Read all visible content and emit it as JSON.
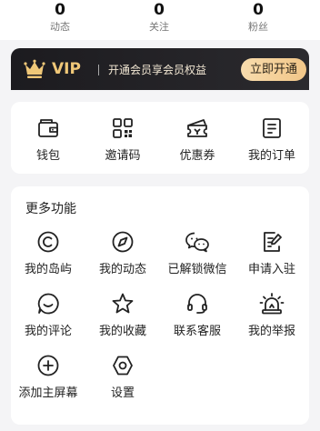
{
  "stats": [
    {
      "value": "0",
      "label": "动态"
    },
    {
      "value": "0",
      "label": "关注"
    },
    {
      "value": "0",
      "label": "粉丝"
    }
  ],
  "vip": {
    "badge": "VIP",
    "tagline": "开通会员享会员权益",
    "button": "立即开通",
    "icon": "crown-icon",
    "gold": "#f0c878"
  },
  "wallet_row": [
    {
      "label": "钱包",
      "icon": "wallet-icon"
    },
    {
      "label": "邀请码",
      "icon": "qr-code-icon"
    },
    {
      "label": "优惠券",
      "icon": "coupon-icon"
    },
    {
      "label": "我的订单",
      "icon": "order-list-icon"
    }
  ],
  "more": {
    "title": "更多功能",
    "items": [
      {
        "label": "我的岛屿",
        "icon": "copyright-circle-icon"
      },
      {
        "label": "我的动态",
        "icon": "compass-icon"
      },
      {
        "label": "已解锁微信",
        "icon": "wechat-icon"
      },
      {
        "label": "申请入驻",
        "icon": "edit-document-icon"
      },
      {
        "label": "我的评论",
        "icon": "comment-smile-icon"
      },
      {
        "label": "我的收藏",
        "icon": "star-icon"
      },
      {
        "label": "联系客服",
        "icon": "headset-icon"
      },
      {
        "label": "我的举报",
        "icon": "alarm-light-icon"
      },
      {
        "label": "添加主屏幕",
        "icon": "add-circle-icon"
      },
      {
        "label": "设置",
        "icon": "settings-hexagon-icon"
      }
    ]
  }
}
